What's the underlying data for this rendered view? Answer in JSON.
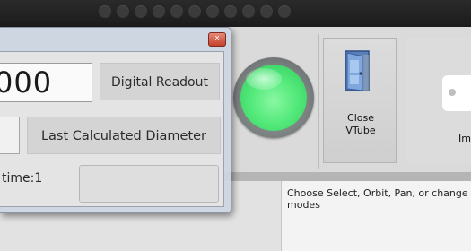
{
  "dialog": {
    "readout_value": "000",
    "digital_readout_label": "Digital Readout",
    "last_calc_label": "Last Calculated Diameter",
    "time_label": "time:1",
    "close_symbol": "x"
  },
  "toolbar": {
    "close_vtube_label": "Close\nVTube",
    "imp_label": "Imp",
    "indicator_color": "#55ea7c"
  },
  "status": {
    "message": "Choose Select, Orbit, Pan, or change modes"
  },
  "icons": [
    "door-icon",
    "close-icon",
    "status-light-icon"
  ]
}
